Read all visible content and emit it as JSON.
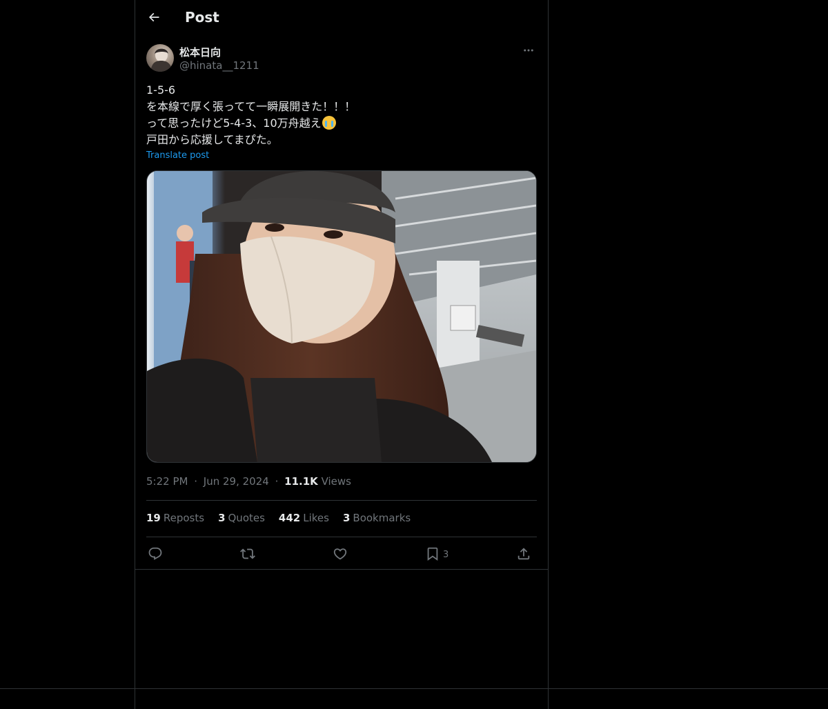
{
  "header": {
    "title": "Post",
    "back_icon": "arrow-left-icon"
  },
  "author": {
    "name": "松本日向",
    "handle": "@hinata__1211",
    "more_icon": "more-horizontal-icon"
  },
  "post": {
    "lines": [
      "1-5-6",
      "を本線で厚く張ってて一瞬展開きた！！！",
      "って思ったけど5-4-3、10万舟越え",
      "戸田から応援してまぴた。"
    ],
    "emoji": "loudly-crying-face-emoji",
    "translate_label": "Translate post"
  },
  "meta": {
    "time": "5:22 PM",
    "separator": "·",
    "date": "Jun 29, 2024",
    "views_count": "11.1K",
    "views_label": "Views"
  },
  "stats": {
    "reposts": {
      "count": "19",
      "label": "Reposts"
    },
    "quotes": {
      "count": "3",
      "label": "Quotes"
    },
    "likes": {
      "count": "442",
      "label": "Likes"
    },
    "bookmarks": {
      "count": "3",
      "label": "Bookmarks"
    }
  },
  "actions": {
    "reply_icon": "reply-icon",
    "repost_icon": "repost-icon",
    "like_icon": "heart-icon",
    "bookmark_icon": "bookmark-icon",
    "bookmark_count": "3",
    "share_icon": "share-icon"
  },
  "colors": {
    "background": "#000000",
    "text_primary": "#e7e9ea",
    "text_secondary": "#71767b",
    "accent": "#1d9bf0",
    "border": "#2f3336"
  }
}
